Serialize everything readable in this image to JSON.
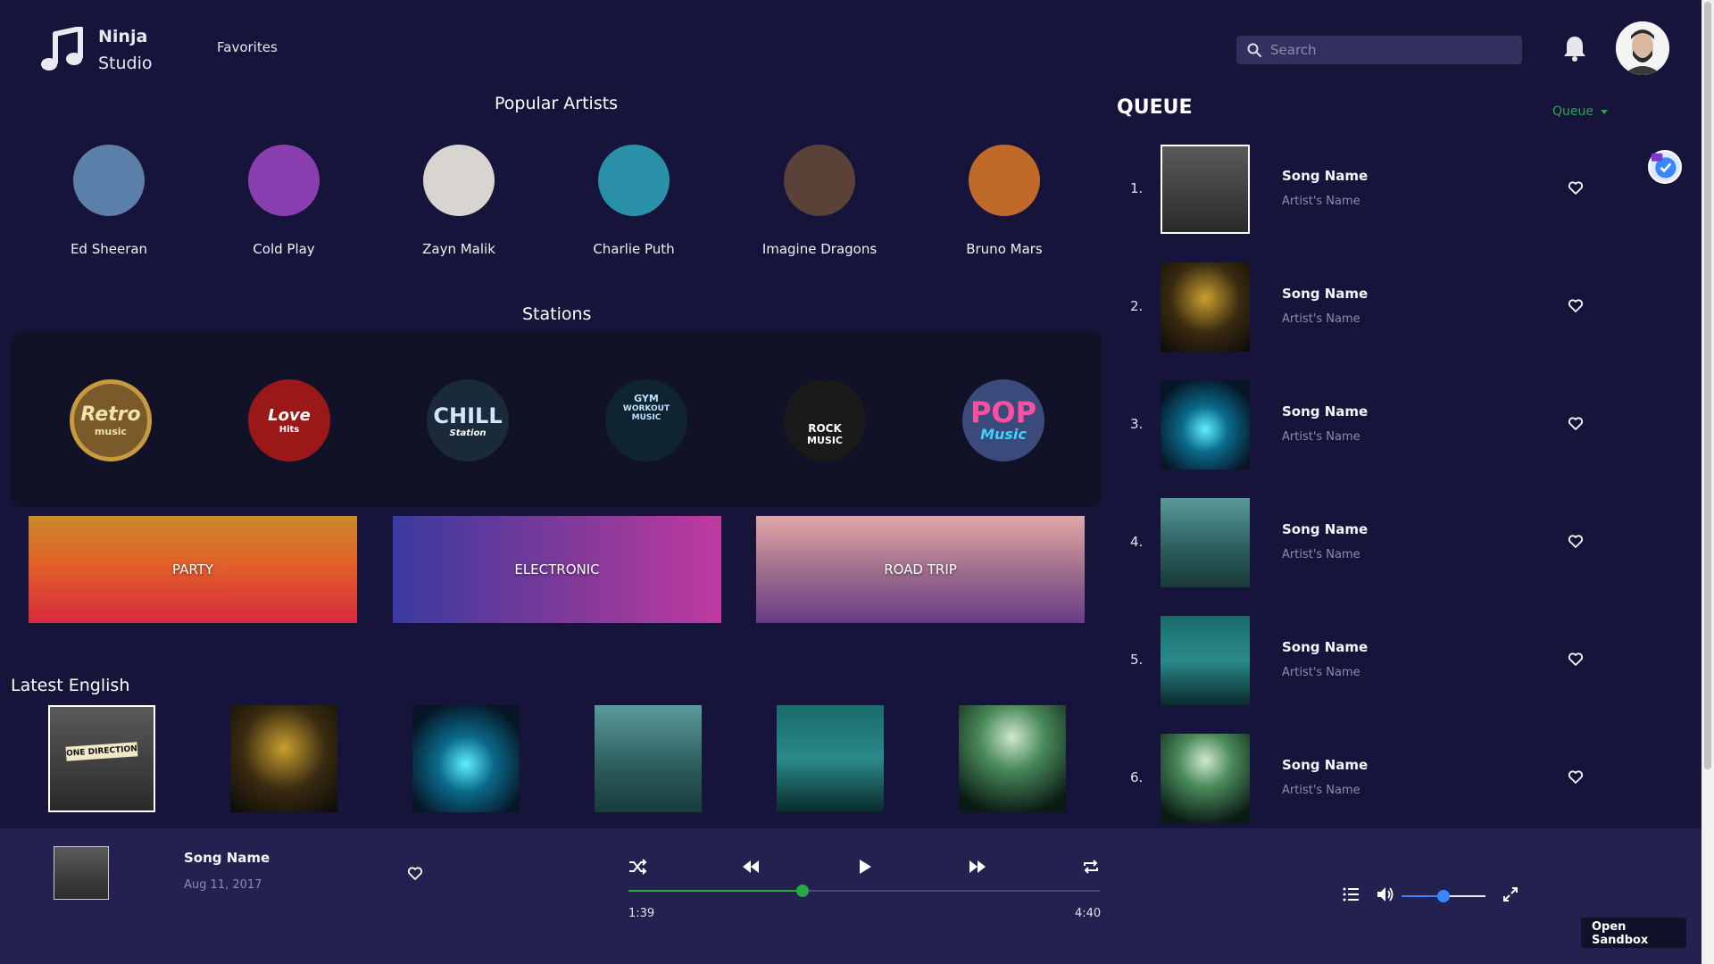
{
  "header": {
    "logo_line1": "Ninja",
    "logo_line2": "Studio",
    "nav_favorites": "Favorites",
    "search_placeholder": "Search"
  },
  "artists_section": {
    "title": "Popular Artists",
    "artists": [
      {
        "name": "Ed Sheeran",
        "color": "#5a7fa8"
      },
      {
        "name": "Cold Play",
        "color": "#8a3fb0"
      },
      {
        "name": "Zayn Malik",
        "color": "#d8d4d0"
      },
      {
        "name": "Charlie Puth",
        "color": "#2a90a8"
      },
      {
        "name": "Imagine Dragons",
        "color": "#5a4238"
      },
      {
        "name": "Bruno Mars",
        "color": "#c06a2a"
      }
    ]
  },
  "stations_section": {
    "title": "Stations",
    "stations": [
      {
        "label_line1": "Retro",
        "label_line2": "music",
        "color": "#7a5a2a"
      },
      {
        "label_line1": "Love",
        "label_line2": "Hits",
        "color": "#9a1818"
      },
      {
        "label_line1": "CHILL",
        "label_line2": "Station",
        "color": "#1a2a3a"
      },
      {
        "label_line1": "GYM",
        "label_line2": "WORKOUT MUSIC",
        "color": "#0e2430"
      },
      {
        "label_line1": "ROCK",
        "label_line2": "MUSIC",
        "color": "#1a1a1a"
      },
      {
        "label_line1": "POP",
        "label_line2": "Music",
        "color": "#3a4a7a"
      }
    ]
  },
  "genres": [
    {
      "label": "PARTY"
    },
    {
      "label": "ELECTRONIC"
    },
    {
      "label": "ROAD TRIP"
    }
  ],
  "latest_section": {
    "title": "Latest English"
  },
  "queue": {
    "title": "QUEUE",
    "dropdown_label": "Queue",
    "items": [
      {
        "num": "1.",
        "song": "Song Name",
        "artist": "Artist's Name"
      },
      {
        "num": "2.",
        "song": "Song Name",
        "artist": "Artist's Name"
      },
      {
        "num": "3.",
        "song": "Song Name",
        "artist": "Artist's Name"
      },
      {
        "num": "4.",
        "song": "Song Name",
        "artist": "Artist's Name"
      },
      {
        "num": "5.",
        "song": "Song Name",
        "artist": "Artist's Name"
      },
      {
        "num": "6.",
        "song": "Song Name",
        "artist": "Artist's Name"
      }
    ]
  },
  "player": {
    "song": "Song Name",
    "date": "Aug 11, 2017",
    "current_time": "1:39",
    "total_time": "4:40",
    "progress_fraction": 0.37,
    "volume_fraction": 0.5
  },
  "sandbox_button": "Open Sandbox",
  "colors": {
    "background": "#16143a",
    "player_bg": "#232150",
    "accent_green": "#27a844",
    "volume_blue": "#3a86ff"
  }
}
